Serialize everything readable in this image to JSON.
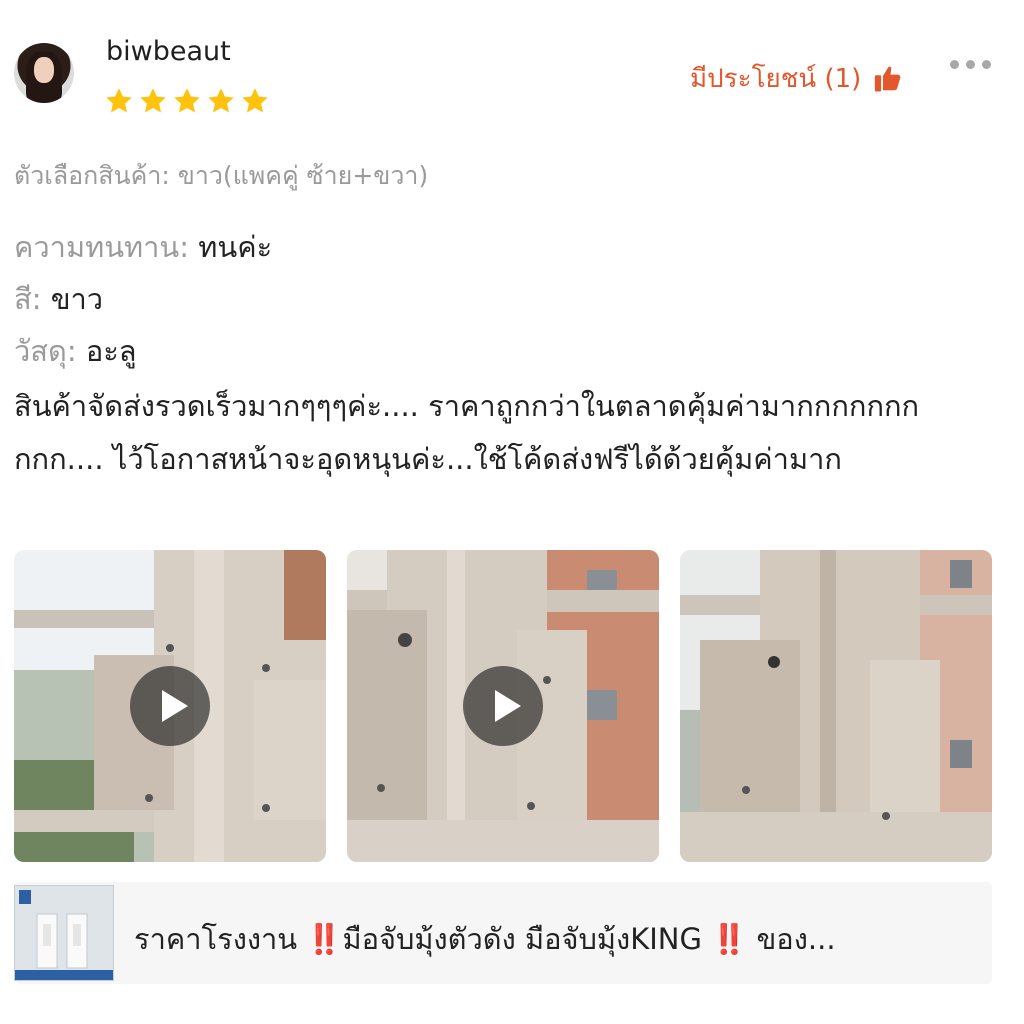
{
  "reviewer": {
    "name": "biwbeaut",
    "rating": 5
  },
  "helpful": {
    "label": "มีประโยชน์ (1)"
  },
  "variant": {
    "text": "ตัวเลือกสินค้า: ขาว(แพคคู่ ซ้าย+ขวา)"
  },
  "attributes": [
    {
      "key": "ความทนทาน:",
      "value": "ทนค่ะ"
    },
    {
      "key": "สี:",
      "value": "ขาว"
    },
    {
      "key": "วัสดุ:",
      "value": "อะลู"
    }
  ],
  "review_text": "สินค้าจัดส่งรวดเร็วมากๆๆๆค่ะ.... ราคาถูกกว่าในตลาดคุ้มค่ามากกกกกกกกกก.... ไว้โอกาสหน้าจะอุดหนุนค่ะ...ใช้โค้ดส่งฟรีได้ด้วยคุ้มค่ามาก",
  "media": [
    {
      "type": "video",
      "icon": "play-icon"
    },
    {
      "type": "video",
      "icon": "play-icon"
    },
    {
      "type": "image"
    }
  ],
  "product": {
    "title_part1": "ราคาโรงงาน ",
    "title_part2": "มือจับมุ้งตัวดัง มือจับมุ้งKING ",
    "title_part3": " ของ...",
    "emphasis": "‼️"
  },
  "colors": {
    "accent": "#e2572c",
    "star": "#ffc20e"
  }
}
